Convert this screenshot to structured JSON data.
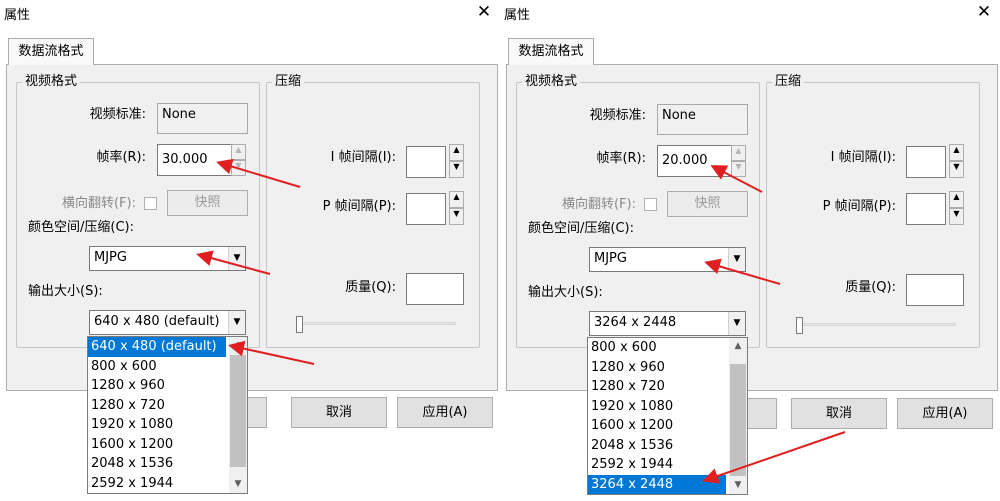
{
  "colors": {
    "highlight": "#0078d7",
    "annotation_arrow": "#e02020"
  },
  "left": {
    "title": "属性",
    "tab": "数据流格式",
    "video_group": "视频格式",
    "compress_group": "压缩",
    "video_standard_label": "视频标准:",
    "video_standard_value": "None",
    "frame_rate_label": "帧率(R):",
    "frame_rate_value": "30.000",
    "flip_label": "横向翻转(F):",
    "snapshot_button": "快照",
    "color_space_label": "颜色空间/压缩(C):",
    "color_space_value": "MJPG",
    "output_size_label": "输出大小(S):",
    "output_size_value": "640 x 480  (default)",
    "i_frame_label": "I 帧间隔(I):",
    "p_frame_label": "P 帧间隔(P):",
    "quality_label": "质量(Q):",
    "cancel_button": "取消",
    "apply_button": "应用(A)",
    "dropdown_items": [
      "640 x 480  (default)",
      "800 x 600",
      "1280 x 960",
      "1280 x 720",
      "1920 x 1080",
      "1600 x 1200",
      "2048 x 1536",
      "2592 x 1944"
    ],
    "selected_index": 0
  },
  "right": {
    "title": "属性",
    "tab": "数据流格式",
    "video_group": "视频格式",
    "compress_group": "压缩",
    "video_standard_label": "视频标准:",
    "video_standard_value": "None",
    "frame_rate_label": "帧率(R):",
    "frame_rate_value": "20.000",
    "flip_label": "横向翻转(F):",
    "snapshot_button": "快照",
    "color_space_label": "颜色空间/压缩(C):",
    "color_space_value": "MJPG",
    "output_size_label": "输出大小(S):",
    "output_size_value": "3264 x 2448",
    "i_frame_label": "I 帧间隔(I):",
    "p_frame_label": "P 帧间隔(P):",
    "quality_label": "质量(Q):",
    "cancel_button": "取消",
    "apply_button": "应用(A)",
    "dropdown_items": [
      "800 x 600",
      "1280 x 960",
      "1280 x 720",
      "1920 x 1080",
      "1600 x 1200",
      "2048 x 1536",
      "2592 x 1944",
      "3264 x 2448"
    ],
    "selected_index": 7
  }
}
